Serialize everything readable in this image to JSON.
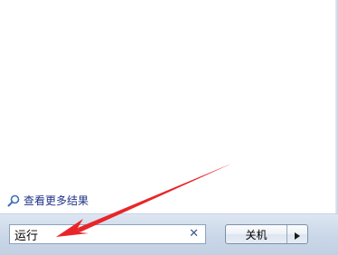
{
  "results": {
    "see_more_label": "查看更多结果",
    "see_more_icon": "search-icon"
  },
  "search": {
    "value": "运行",
    "clear_glyph": "✕"
  },
  "shutdown": {
    "label": "关机",
    "options_icon": "triangle-right-icon"
  },
  "annotation": {
    "arrow_color": "#e8262a"
  }
}
